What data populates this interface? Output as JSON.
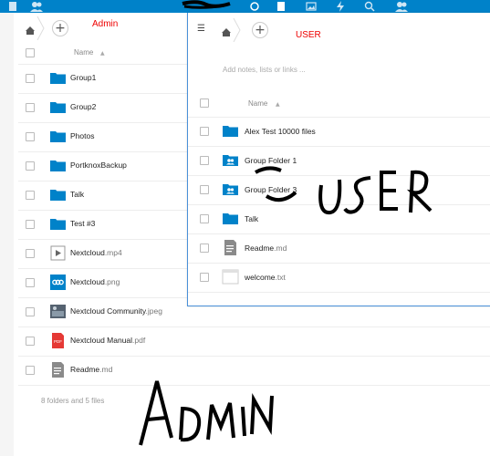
{
  "topbar": {
    "icons": [
      "circle-icon",
      "file-icon",
      "image-icon",
      "activity-icon",
      "search-icon",
      "contacts-icon"
    ],
    "color": "#0082c9"
  },
  "admin": {
    "label": "Admin",
    "column_name": "Name",
    "rows": [
      {
        "name": "Group1",
        "ext": "",
        "type": "folder"
      },
      {
        "name": "Group2",
        "ext": "",
        "type": "folder"
      },
      {
        "name": "Photos",
        "ext": "",
        "type": "folder"
      },
      {
        "name": "PortknoxBackup",
        "ext": "",
        "type": "folder"
      },
      {
        "name": "Talk",
        "ext": "",
        "type": "folder"
      },
      {
        "name": "Test #3",
        "ext": "",
        "type": "folder"
      },
      {
        "name": "Nextcloud",
        "ext": ".mp4",
        "type": "video"
      },
      {
        "name": "Nextcloud",
        "ext": ".png",
        "type": "png"
      },
      {
        "name": "Nextcloud Community",
        "ext": ".jpeg",
        "type": "jpeg"
      },
      {
        "name": "Nextcloud Manual",
        "ext": ".pdf",
        "type": "pdf"
      },
      {
        "name": "Readme",
        "ext": ".md",
        "type": "md"
      }
    ],
    "summary": "8 folders and 5 files",
    "handwriting": "ADMIN"
  },
  "user": {
    "label": "USER",
    "notes_placeholder": "Add notes, lists or links ...",
    "column_name": "Name",
    "rows": [
      {
        "name": "Alex Test 10000 files",
        "ext": "",
        "type": "folder"
      },
      {
        "name": "Group Folder 1",
        "ext": "",
        "type": "group-folder"
      },
      {
        "name": "Group Folder 3",
        "ext": "",
        "type": "group-folder"
      },
      {
        "name": "Talk",
        "ext": "",
        "type": "folder"
      },
      {
        "name": "Readme",
        "ext": ".md",
        "type": "md"
      },
      {
        "name": "welcome",
        "ext": ".txt",
        "type": "txt"
      }
    ],
    "handwriting": "USER"
  },
  "colors": {
    "folder": "#0082c9",
    "annotation_red": "#e00000",
    "window_border": "#4a90d9"
  }
}
